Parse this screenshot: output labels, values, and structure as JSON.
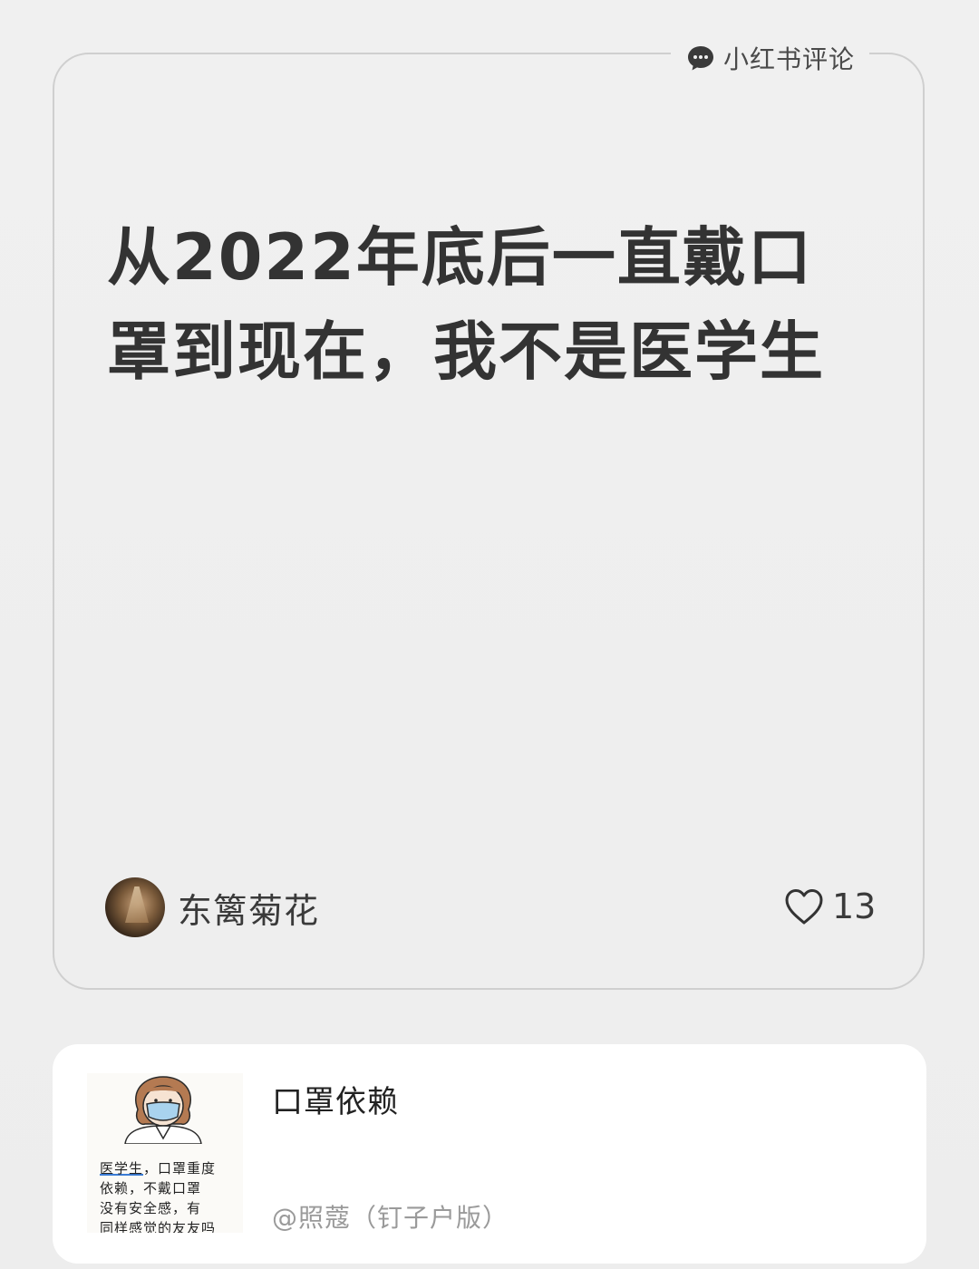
{
  "source": {
    "label": "小红书评论",
    "icon": "chat-bubble-icon"
  },
  "comment": {
    "line1": "从2022年底后一直戴口",
    "line2": "罩到现在，我不是医学生",
    "author": "东篱菊花",
    "like_count": "13",
    "like_icon": "heart-outline-icon"
  },
  "post": {
    "title": "口罩依赖",
    "author": "@照蔻（钉子户版）",
    "thumbnail": {
      "highlight": "医学生",
      "rest_line1": "，口罩重度",
      "line2": "依赖，不戴口罩",
      "line3": "没有安全感，有",
      "line4": "同样感觉的友友吗"
    }
  }
}
